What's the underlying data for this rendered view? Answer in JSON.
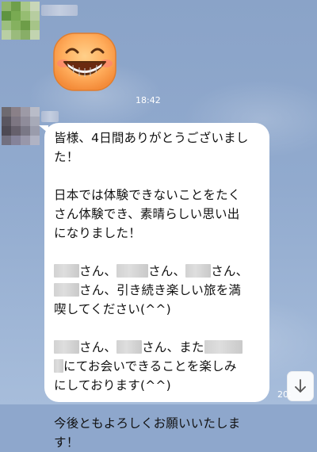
{
  "sticker_message": {
    "time": "18:42",
    "sticker": "grinning-face-emoji"
  },
  "text_message": {
    "paragraphs": [
      {
        "lines": [
          [
            {
              "t": "皆様、4日間ありがとうございまし"
            }
          ],
          [
            {
              "t": "た！"
            }
          ]
        ]
      },
      {
        "lines": [
          [
            {
              "t": "日本では体験できないことをたく"
            }
          ],
          [
            {
              "t": "さん体験でき、素晴らしい思い出"
            }
          ],
          [
            {
              "t": "になりました！"
            }
          ]
        ]
      },
      {
        "lines": [
          [
            {
              "r": 32
            },
            {
              "t": "さん、"
            },
            {
              "r": 40
            },
            {
              "t": "さん、"
            },
            {
              "r": 32
            },
            {
              "t": "さん、"
            }
          ],
          [
            {
              "r": 32
            },
            {
              "t": "さん、引き続き楽しい旅を満"
            }
          ],
          [
            {
              "t": "喫してください(^^)"
            }
          ]
        ]
      },
      {
        "lines": [
          [
            {
              "r": 32
            },
            {
              "t": "さん、"
            },
            {
              "r": 32
            },
            {
              "t": "さん、また"
            },
            {
              "r": 48
            }
          ],
          [
            {
              "r": 12
            },
            {
              "t": "にてお会いできることを楽しみ"
            }
          ],
          [
            {
              "t": "にしております(^^)"
            }
          ]
        ]
      },
      {
        "lines": [
          [
            {
              "t": "今後ともよろしくお願いいたしま"
            }
          ],
          [
            {
              "t": "す！"
            }
          ]
        ]
      }
    ],
    "time_partial": "20:"
  },
  "colors": {
    "background": "#8ea7cc",
    "bubble": "#ffffff",
    "text": "#111111",
    "timestamp": "#ffffff"
  },
  "icons": {
    "scroll_down": "arrow-down-icon"
  }
}
